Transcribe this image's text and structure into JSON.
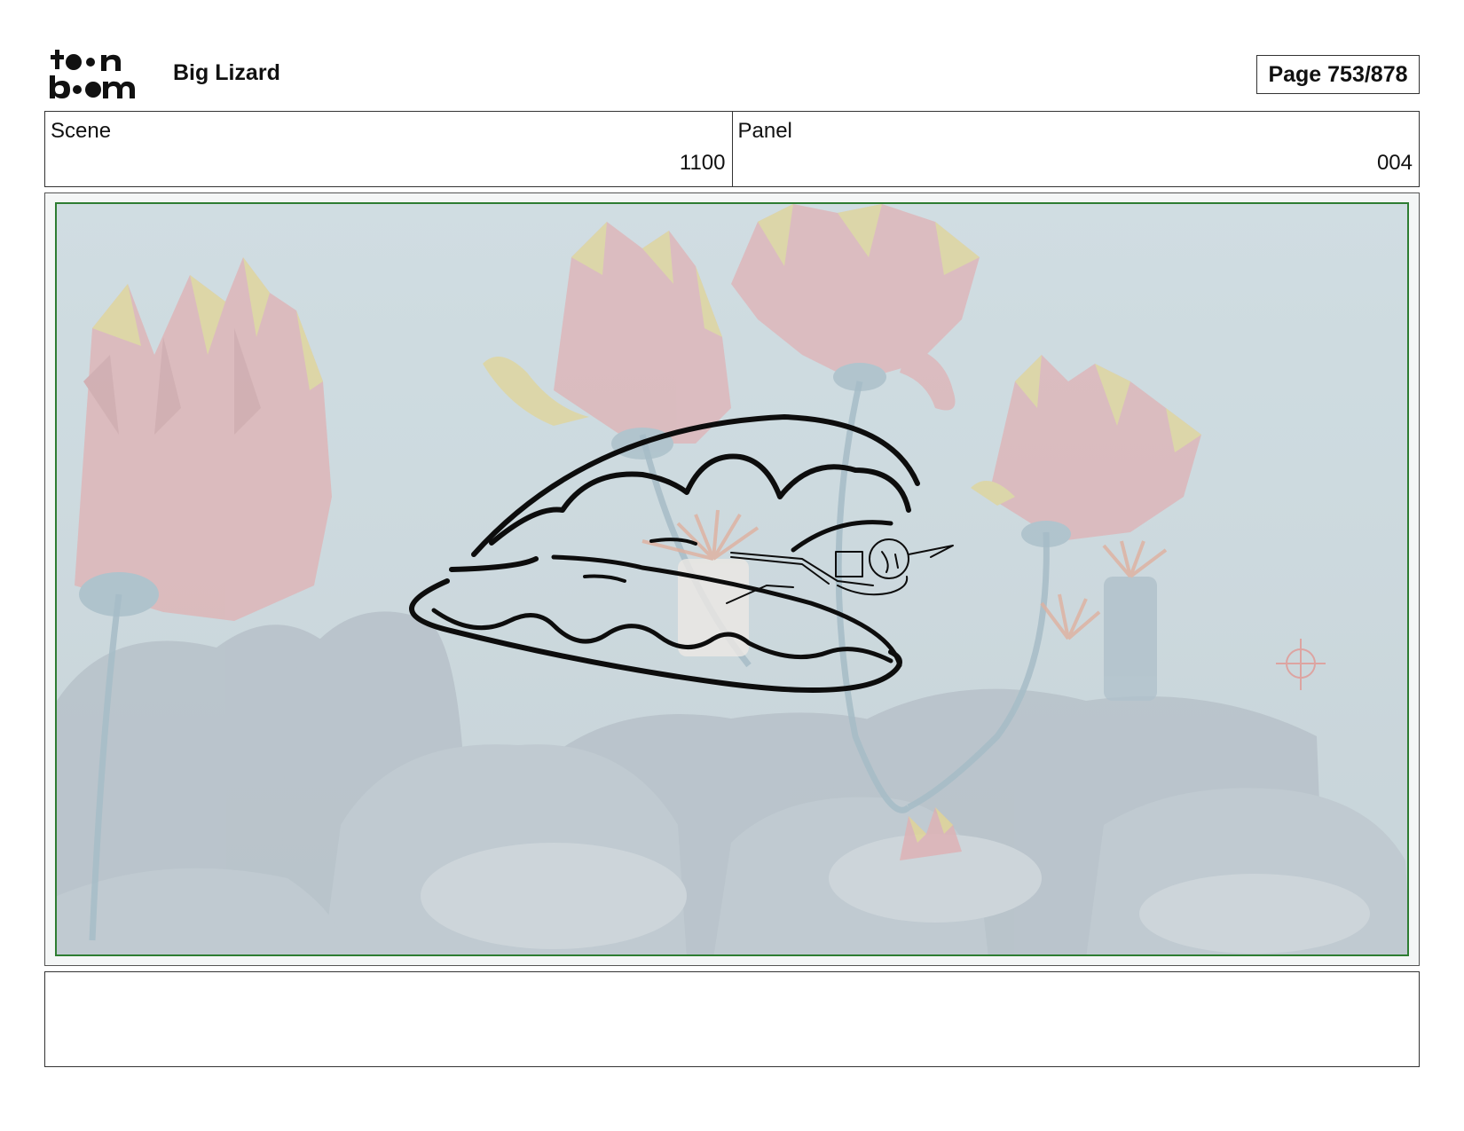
{
  "header": {
    "logo_icon": "toonboom-logo-icon",
    "logo_text": "toon boom",
    "project_title": "Big Lizard",
    "page_label": "Page 753/878"
  },
  "scene": {
    "label": "Scene",
    "value": "1100"
  },
  "panel": {
    "label": "Panel",
    "value": "004"
  },
  "frame": {
    "border_color": "#2e7d32",
    "background_color": "#c4d3d9"
  },
  "notes": {
    "text": ""
  }
}
